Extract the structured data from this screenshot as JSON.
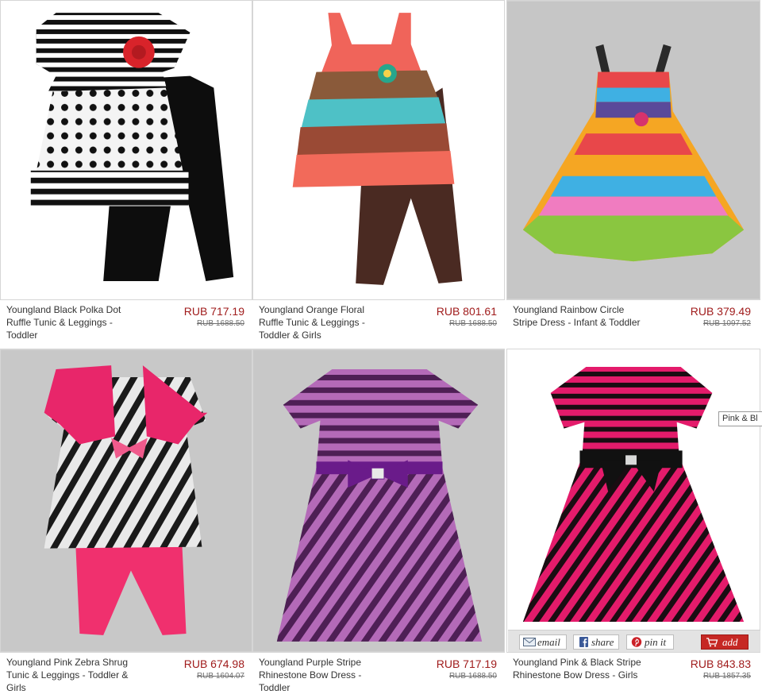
{
  "products": [
    {
      "name": "Youngland Black Polka Dot Ruffle Tunic & Leggings - Toddler",
      "price": "RUB 717.19",
      "old_price": "RUB 1688.50"
    },
    {
      "name": "Youngland Orange Floral Ruffle Tunic & Leggings - Toddler & Girls",
      "price": "RUB 801.61",
      "old_price": "RUB 1688.50"
    },
    {
      "name": "Youngland Rainbow Circle Stripe Dress - Infant & Toddler",
      "price": "RUB 379.49",
      "old_price": "RUB 1097.52"
    },
    {
      "name": "Youngland Pink Zebra Shrug Tunic & Leggings - Toddler & Girls",
      "price": "RUB 674.98",
      "old_price": "RUB 1604.07"
    },
    {
      "name": "Youngland Purple Stripe Rhinestone Bow Dress - Toddler",
      "price": "RUB 717.19",
      "old_price": "RUB 1688.50"
    },
    {
      "name": "Youngland Pink & Black Stripe Rhinestone Bow Dress - Girls",
      "price": "RUB 843.83",
      "old_price": "RUB 1857.35"
    }
  ],
  "share_bar": {
    "email_label": "email",
    "share_label": "share",
    "pin_label": "pin it",
    "add_label": "add"
  },
  "tooltip": "Pink & Bl",
  "colors": {
    "price": "#a01c1c",
    "add_button": "#c62824",
    "facebook": "#3b5998",
    "pinterest": "#cb2027"
  },
  "icons": [
    "envelope-icon",
    "facebook-icon",
    "pinterest-icon",
    "cart-icon"
  ]
}
